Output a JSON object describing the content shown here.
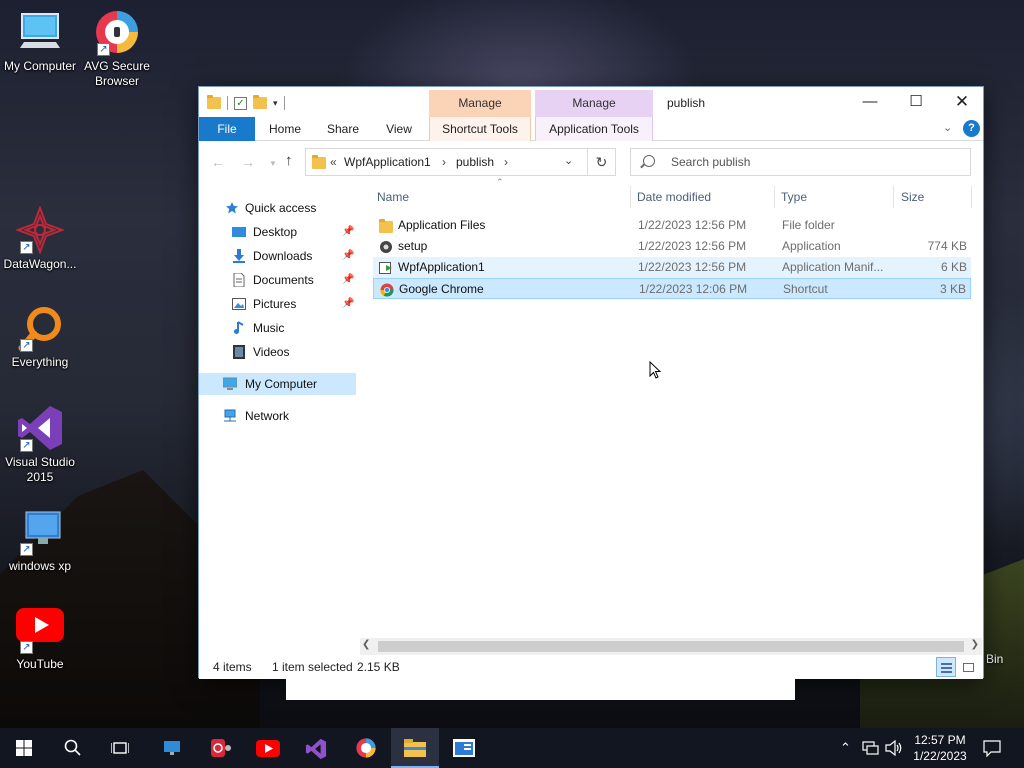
{
  "desktop": {
    "icons": [
      {
        "label": "My Computer"
      },
      {
        "label": "AVG Secure Browser"
      },
      {
        "label": "DataWagon..."
      },
      {
        "label": "Everything"
      },
      {
        "label": "Visual Studio 2015"
      },
      {
        "label": "windows xp"
      },
      {
        "label": "YouTube"
      },
      {
        "label": "Bin"
      }
    ]
  },
  "window": {
    "title": "publish",
    "context_tabs": [
      {
        "group": "Manage",
        "tab": "Shortcut Tools",
        "color": "#fbd3b6"
      },
      {
        "group": "Manage",
        "tab": "Application Tools",
        "color": "#e7d2f4"
      }
    ],
    "ribbon_tabs": [
      "File",
      "Home",
      "Share",
      "View"
    ],
    "address": {
      "prefix": "«",
      "segments": [
        "WpfApplication1",
        "publish"
      ]
    },
    "search_placeholder": "Search publish",
    "nav_pane": [
      {
        "label": "Quick access",
        "icon": "star-icon"
      },
      {
        "label": "Desktop",
        "icon": "desktop-icon",
        "pinned": true
      },
      {
        "label": "Downloads",
        "icon": "download-icon",
        "pinned": true
      },
      {
        "label": "Documents",
        "icon": "documents-icon",
        "pinned": true
      },
      {
        "label": "Pictures",
        "icon": "pictures-icon",
        "pinned": true
      },
      {
        "label": "Music",
        "icon": "music-icon"
      },
      {
        "label": "Videos",
        "icon": "videos-icon"
      },
      {
        "label": "My Computer",
        "icon": "computer-icon",
        "selected": true
      },
      {
        "label": "Network",
        "icon": "network-icon"
      }
    ],
    "columns": [
      "Name",
      "Date modified",
      "Type",
      "Size"
    ],
    "files": [
      {
        "name": "Application Files",
        "date": "1/22/2023 12:56 PM",
        "type": "File folder",
        "size": "",
        "icon": "folder-icon"
      },
      {
        "name": "setup",
        "date": "1/22/2023 12:56 PM",
        "type": "Application",
        "size": "774 KB",
        "icon": "setup-icon"
      },
      {
        "name": "WpfApplication1",
        "date": "1/22/2023 12:56 PM",
        "type": "Application Manif...",
        "size": "6 KB",
        "icon": "manifest-icon"
      },
      {
        "name": "Google Chrome",
        "date": "1/22/2023 12:06 PM",
        "type": "Shortcut",
        "size": "3 KB",
        "icon": "chrome-icon"
      }
    ],
    "status": {
      "items": "4 items",
      "selected": "1 item selected",
      "size": "2.15 KB"
    }
  },
  "taskbar": {
    "time": "12:57 PM",
    "date": "1/22/2023"
  },
  "colors": {
    "accent": "#1979ca",
    "selection": "#cce8ff",
    "hover": "#e5f3ff"
  }
}
